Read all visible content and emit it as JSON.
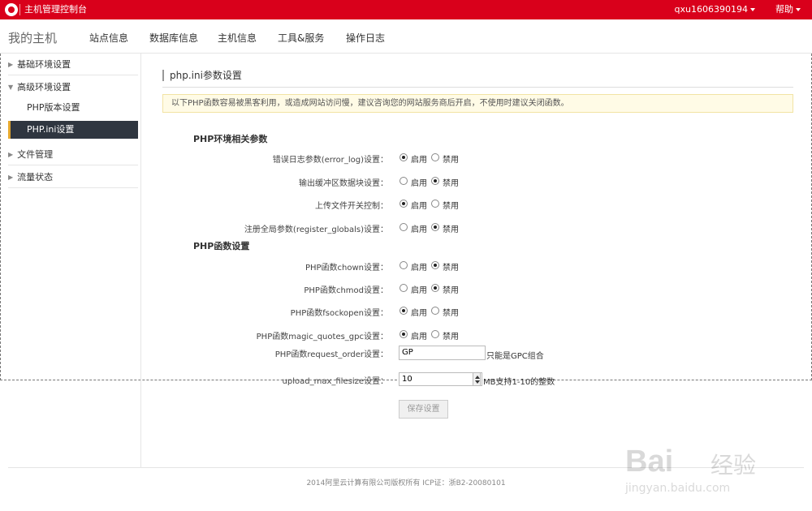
{
  "topbar": {
    "title": "主机管理控制台",
    "user": "qxu1606390194",
    "help": "帮助"
  },
  "nav": {
    "brand": "我的主机",
    "items": [
      "站点信息",
      "数据库信息",
      "主机信息",
      "工具&服务",
      "操作日志"
    ]
  },
  "sidebar": {
    "items": [
      {
        "label": "基础环境设置",
        "icon": "triangle-right-icon"
      },
      {
        "label": "高级环境设置",
        "icon": "triangle-down-icon"
      },
      {
        "label": "PHP版本设置"
      },
      {
        "label": "PHP.ini设置"
      },
      {
        "label": "文件管理",
        "icon": "triangle-right-icon"
      },
      {
        "label": "流量状态",
        "icon": "triangle-right-icon"
      }
    ]
  },
  "main": {
    "title": "php.ini参数设置",
    "notice": "以下PHP函数容易被黑客利用，或造成网站访问慢，建议咨询您的网站服务商后开启，不使用时建议关闭函数。",
    "group1": "PHP环境相关参数",
    "group2": "PHP函数设置",
    "on_label": "启用",
    "off_label": "禁用",
    "rows": [
      {
        "label": "错误日志参数(error_log)设置：",
        "value": "on"
      },
      {
        "label": "输出缓冲区数据块设置：",
        "value": "off"
      },
      {
        "label": "上传文件开关控制：",
        "value": "on"
      },
      {
        "label": "注册全局参数(register_globals)设置：",
        "value": "off"
      },
      {
        "label": "PHP函数chown设置：",
        "value": "off"
      },
      {
        "label": "PHP函数chmod设置：",
        "value": "off"
      },
      {
        "label": "PHP函数fsockopen设置：",
        "value": "on"
      },
      {
        "label": "PHP函数magic_quotes_gpc设置：",
        "value": "on"
      }
    ],
    "request_order": {
      "label": "PHP函数request_order设置：",
      "value": "GP",
      "hint": "只能是GPC组合"
    },
    "upload_max": {
      "label": "upload_max_filesize设置：",
      "value": "10",
      "hint": "MB支持1-10的整数"
    },
    "save": "保存设置"
  },
  "footer": "2014阿里云计算有限公司版权所有 ICP证：浙B2-20080101",
  "watermark": {
    "brand": "Bai",
    "cn": "经验",
    "url": "jingyan.baidu.com"
  },
  "colors": {
    "topbar": "#d9001b",
    "active_nav": "#2f3640",
    "accent": "#e5a82e"
  }
}
